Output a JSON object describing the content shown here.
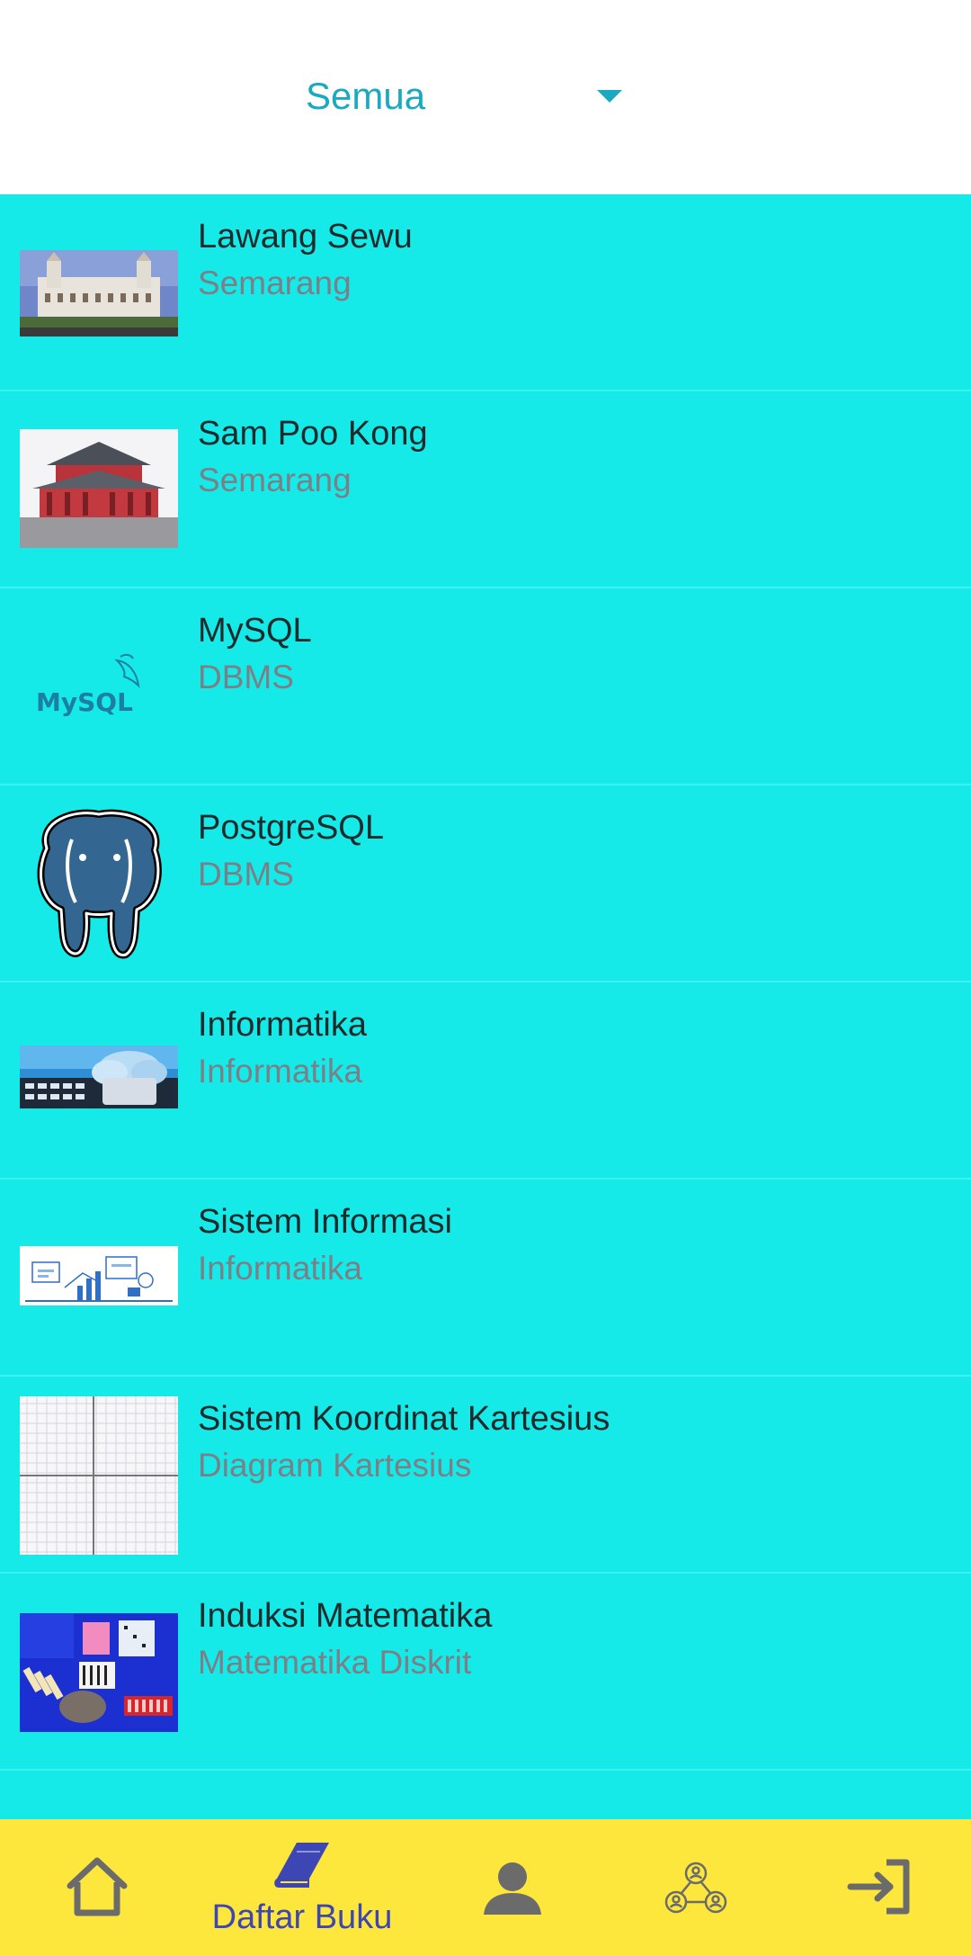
{
  "filter": {
    "selected": "Semua"
  },
  "items": [
    {
      "title": "Lawang Sewu",
      "subtitle": "Semarang"
    },
    {
      "title": "Sam Poo Kong",
      "subtitle": "Semarang"
    },
    {
      "title": "MySQL",
      "subtitle": "DBMS"
    },
    {
      "title": "PostgreSQL",
      "subtitle": "DBMS"
    },
    {
      "title": "Informatika",
      "subtitle": "Informatika"
    },
    {
      "title": "Sistem Informasi",
      "subtitle": "Informatika"
    },
    {
      "title": "Sistem Koordinat Kartesius",
      "subtitle": "Diagram Kartesius"
    },
    {
      "title": "Induksi Matematika",
      "subtitle": "Matematika Diskrit"
    }
  ],
  "thumbnails": {
    "mysql_logo_text": "MySQL"
  },
  "bottom_nav": {
    "items": [
      {
        "icon": "home-icon"
      },
      {
        "icon": "book-icon",
        "label": "Daftar Buku",
        "active": true
      },
      {
        "icon": "person-icon"
      },
      {
        "icon": "group-network-icon"
      },
      {
        "icon": "login-icon"
      }
    ]
  },
  "colors": {
    "list_background": "#16eae8",
    "accent": "#19aac0",
    "bottom_nav": "#fde73c",
    "active_nav": "#3d46b2",
    "inactive_nav": "#6b6b6b"
  }
}
